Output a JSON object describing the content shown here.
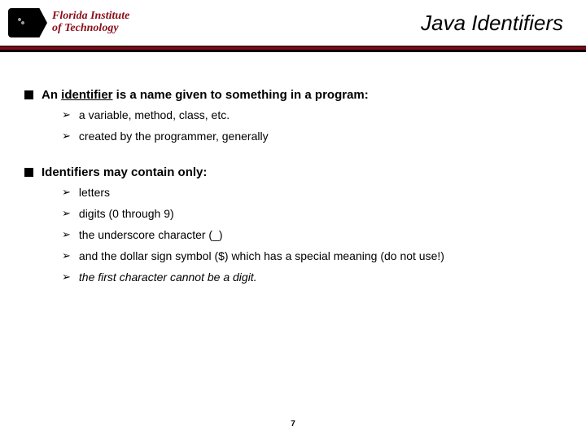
{
  "logo": {
    "line1": "Florida Institute",
    "line2": "of Technology"
  },
  "title": "Java Identifiers",
  "points": [
    {
      "prefix": "An ",
      "keyword": "identifier",
      "suffix": " is a name given to something in a program:",
      "subs": [
        {
          "text": "a variable, method, class, etc.",
          "italic": false
        },
        {
          "text": "created by the programmer, generally",
          "italic": false
        }
      ]
    },
    {
      "prefix": "",
      "keyword": "",
      "suffix": "Identifiers may contain only:",
      "subs": [
        {
          "text": "letters",
          "italic": false
        },
        {
          "text": "digits (0 through 9)",
          "italic": false
        },
        {
          "text": "the underscore character (_)",
          "italic": false
        },
        {
          "text": "and the dollar sign symbol ($) which has a special meaning (do not use!)",
          "italic": false
        },
        {
          "text": "the first character cannot be a digit.",
          "italic": true
        }
      ]
    }
  ],
  "page_number": "7",
  "glyphs": {
    "arrow": "➢"
  }
}
